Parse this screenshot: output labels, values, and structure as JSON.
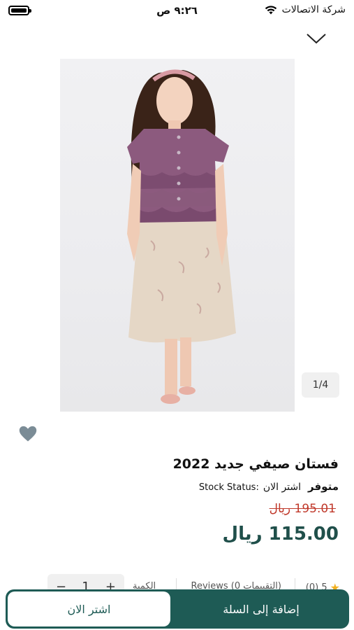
{
  "status_bar": {
    "time": "٩:٢٦ ص",
    "carrier": "شركة الاتصالات"
  },
  "gallery": {
    "counter": "1/4",
    "image_alt": "product-photo"
  },
  "product": {
    "title": "فستان صيفي  جديد 2022",
    "stock_label": "Stock Status:",
    "stock_buy_now": "اشتر الان",
    "stock_value": "متوفر",
    "old_price": "195.01 ريال",
    "new_price": "115.00 ريال"
  },
  "meta": {
    "rating_text": "5 (0)",
    "reviews_text": "Reviews (0 التقييمات)",
    "quantity_label": "الكمية",
    "qty_minus": "−",
    "qty_value": "1",
    "qty_plus": "+"
  },
  "actions": {
    "add_to_cart": "إضافة إلى السلة",
    "buy_now": "اشتر الان"
  },
  "colors": {
    "brand": "#1e5b55",
    "old_price": "#c0392b",
    "new_price": "#1f4f4a",
    "star": "#f2b01e"
  }
}
